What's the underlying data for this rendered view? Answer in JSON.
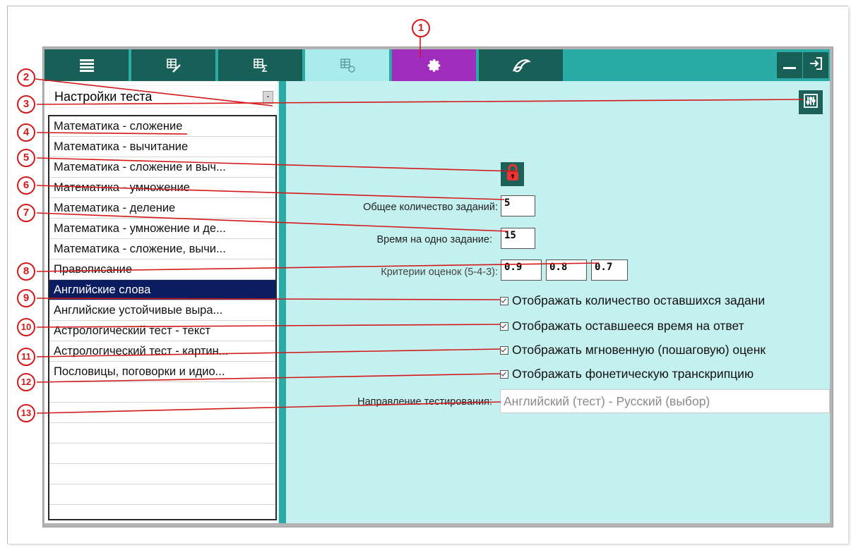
{
  "combo": {
    "value": "Настройки теста"
  },
  "list_items": [
    "Математика - сложение",
    "Математика - вычитание",
    "Математика - сложение и выч...",
    "Математика - умножение",
    "Математика - деление",
    "Математика - умножение и де...",
    "Математика - сложение, вычи...",
    "Правописание",
    "Английские слова",
    "Английские устойчивые выра...",
    "Астрологический тест - текст",
    "Астрологический тест - картин...",
    "Пословицы, поговорки и идио...",
    "",
    "",
    "",
    "",
    "",
    ""
  ],
  "selected_index": 8,
  "settings": {
    "total_tasks_label": "Общее количество заданий:",
    "total_tasks_value": "5",
    "time_label": "Время на одно задание:",
    "time_value": "15",
    "criteria_label": "Критерии оценок (5-4-3):",
    "criteria_5": "0.9",
    "criteria_4": "0.8",
    "criteria_3": "0.7",
    "check_remaining_tasks": "Отображать количество оставшихся задани",
    "check_remaining_time": "Отображать оставшееся время на ответ",
    "check_instant_score": "Отображать мгновенную (пошаговую) оценк",
    "check_transcription": "Отображать фонетическую транскрипцию",
    "direction_label": "Направление тестирования:",
    "direction_value": "Английский (тест) - Русский (выбор)"
  },
  "callouts": [
    "1",
    "2",
    "3",
    "4",
    "5",
    "6",
    "7",
    "8",
    "9",
    "10",
    "11",
    "12",
    "13"
  ],
  "colors": {
    "toolbar": "#2aaba6",
    "tab_dark": "#185f58",
    "tab_active": "#a8ecee",
    "tab_settings": "#a02cbb",
    "panel_bg": "#c4f0ef",
    "selection": "#0b1c60",
    "callout": "#d21a1a"
  }
}
